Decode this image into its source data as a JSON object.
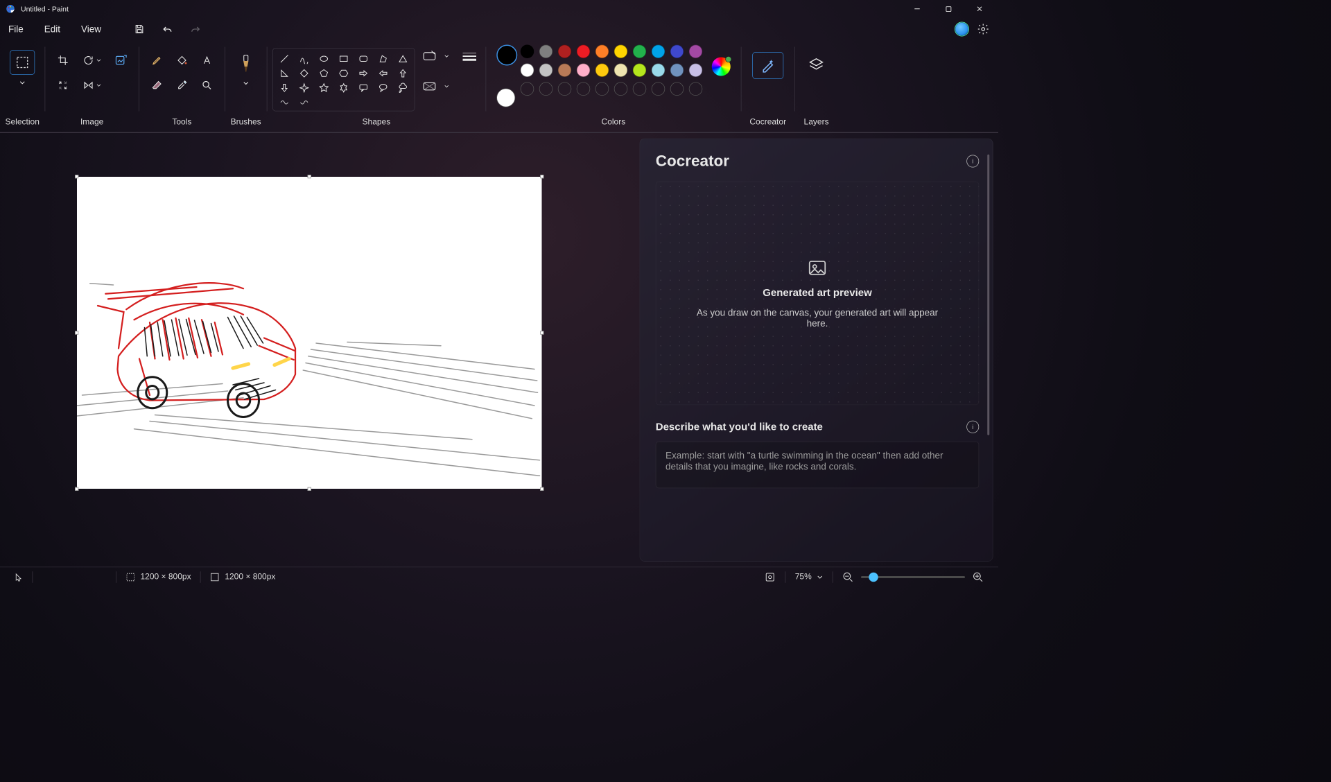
{
  "titlebar": {
    "title": "Untitled - Paint"
  },
  "menu": {
    "file": "File",
    "edit": "Edit",
    "view": "View"
  },
  "ribbon": {
    "selection_label": "Selection",
    "image_label": "Image",
    "tools_label": "Tools",
    "brushes_label": "Brushes",
    "shapes_label": "Shapes",
    "colors_label": "Colors",
    "cocreator_label": "Cocreator",
    "layers_label": "Layers"
  },
  "colors": {
    "primary": "#000000",
    "secondary": "#ffffff",
    "row1": [
      "#000000",
      "#7f7f7f",
      "#b02020",
      "#ed1c24",
      "#ff7f27",
      "#ffd400",
      "#22b14c",
      "#00a2e8",
      "#3f48cc",
      "#a349a4"
    ],
    "row2": [
      "#ffffff",
      "#c3c3c3",
      "#b97a57",
      "#ffaec9",
      "#ffc90e",
      "#efe4b0",
      "#b5e61d",
      "#99d9ea",
      "#7092be",
      "#c8bfe7"
    ]
  },
  "cocreator": {
    "title": "Cocreator",
    "preview_title": "Generated art preview",
    "preview_sub": "As you draw on the canvas, your generated art will appear here.",
    "describe_label": "Describe what you'd like to create",
    "placeholder": "Example: start with \"a turtle swimming in the ocean\" then add other details that you imagine, like rocks and corals."
  },
  "status": {
    "selection_size": "1200 × 800px",
    "canvas_size": "1200 × 800px",
    "zoom": "75%"
  }
}
